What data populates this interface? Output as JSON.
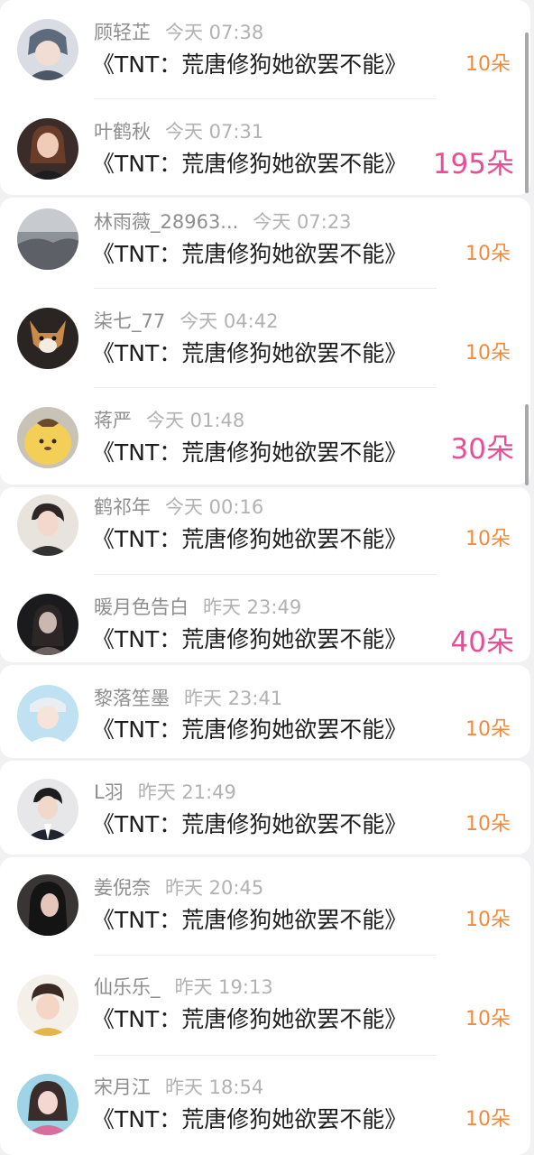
{
  "messages": [
    {
      "user": "顾轻芷",
      "time": "今天 07:38",
      "text": "《TNT：荒唐修狗她欲罢不能》",
      "gift": "10朵",
      "avatar_icon": "avatar-illustrated-boy-icon",
      "avatar_colors": [
        "#7b8a9c",
        "#d9dde3"
      ]
    },
    {
      "user": "叶鹤秋",
      "time": "今天 07:31",
      "text": "《TNT：荒唐修狗她欲罢不能》",
      "gift": "195朵",
      "avatar_icon": "avatar-girl-photo-icon",
      "avatar_colors": [
        "#3b2c2a",
        "#e6b9a6"
      ]
    },
    {
      "user": "林雨薇_28963...",
      "time": "今天 07:23",
      "text": "《TNT：荒唐修狗她欲罢不能》",
      "gift": "10朵",
      "avatar_icon": "avatar-landscape-icon",
      "avatar_colors": [
        "#a9aeb4",
        "#5d6067"
      ]
    },
    {
      "user": "柒七_77",
      "time": "今天 04:42",
      "text": "《TNT：荒唐修狗她欲罢不能》",
      "gift": "10朵",
      "avatar_icon": "avatar-corgi-icon",
      "avatar_colors": [
        "#2a2522",
        "#c98a4a"
      ]
    },
    {
      "user": "蒋严",
      "time": "今天 01:48",
      "text": "《TNT：荒唐修狗她欲罢不能》",
      "gift": "30朵",
      "avatar_icon": "avatar-pompompurin-icon",
      "avatar_colors": [
        "#f3cf58",
        "#6b4b2a"
      ]
    },
    {
      "user": "鹤祁年",
      "time": "今天 00:16",
      "text": "《TNT：荒唐修狗她欲罢不能》",
      "gift": "10朵",
      "avatar_icon": "avatar-boy-photo-icon",
      "avatar_colors": [
        "#e8e3dc",
        "#2d2624"
      ]
    },
    {
      "user": "暖月色告白",
      "time": "昨天 23:49",
      "text": "《TNT：荒唐修狗她欲罢不能》",
      "gift": "40朵",
      "avatar_icon": "avatar-dark-girl-icon",
      "avatar_colors": [
        "#1b1b1d",
        "#6b6160"
      ]
    },
    {
      "user": "黎落笙墨",
      "time": "昨天 23:41",
      "text": "《TNT：荒唐修狗她欲罢不能》",
      "gift": "10朵",
      "avatar_icon": "avatar-cartoon-boy-icon",
      "avatar_colors": [
        "#bfe1f1",
        "#ffffff"
      ]
    },
    {
      "user": "L羽",
      "time": "昨天 21:49",
      "text": "《TNT：荒唐修狗她欲罢不能》",
      "gift": "10朵",
      "avatar_icon": "avatar-man-suit-icon",
      "avatar_colors": [
        "#e7e7ea",
        "#1f2430"
      ]
    },
    {
      "user": "姜倪奈",
      "time": "昨天 20:45",
      "text": "《TNT：荒唐修狗她欲罢不能》",
      "gift": "10朵",
      "avatar_icon": "avatar-dark-hair-girl-icon",
      "avatar_colors": [
        "#141414",
        "#d9a9a3"
      ]
    },
    {
      "user": "仙乐乐_",
      "time": "昨天 19:13",
      "text": "《TNT：荒唐修狗她欲罢不能》",
      "gift": "10朵",
      "avatar_icon": "avatar-child-icon",
      "avatar_colors": [
        "#f4efe8",
        "#3a2a23"
      ]
    },
    {
      "user": "宋月江",
      "time": "昨天 18:54",
      "text": "《TNT：荒唐修狗她欲罢不能》",
      "gift": "10朵",
      "avatar_icon": "avatar-costume-girl-icon",
      "avatar_colors": [
        "#9fd3e6",
        "#f3d7d0"
      ]
    }
  ],
  "colors": {
    "gift_small": "#f08a3c",
    "gift_large": "#ea4c96",
    "background": "#f1f1f3"
  }
}
